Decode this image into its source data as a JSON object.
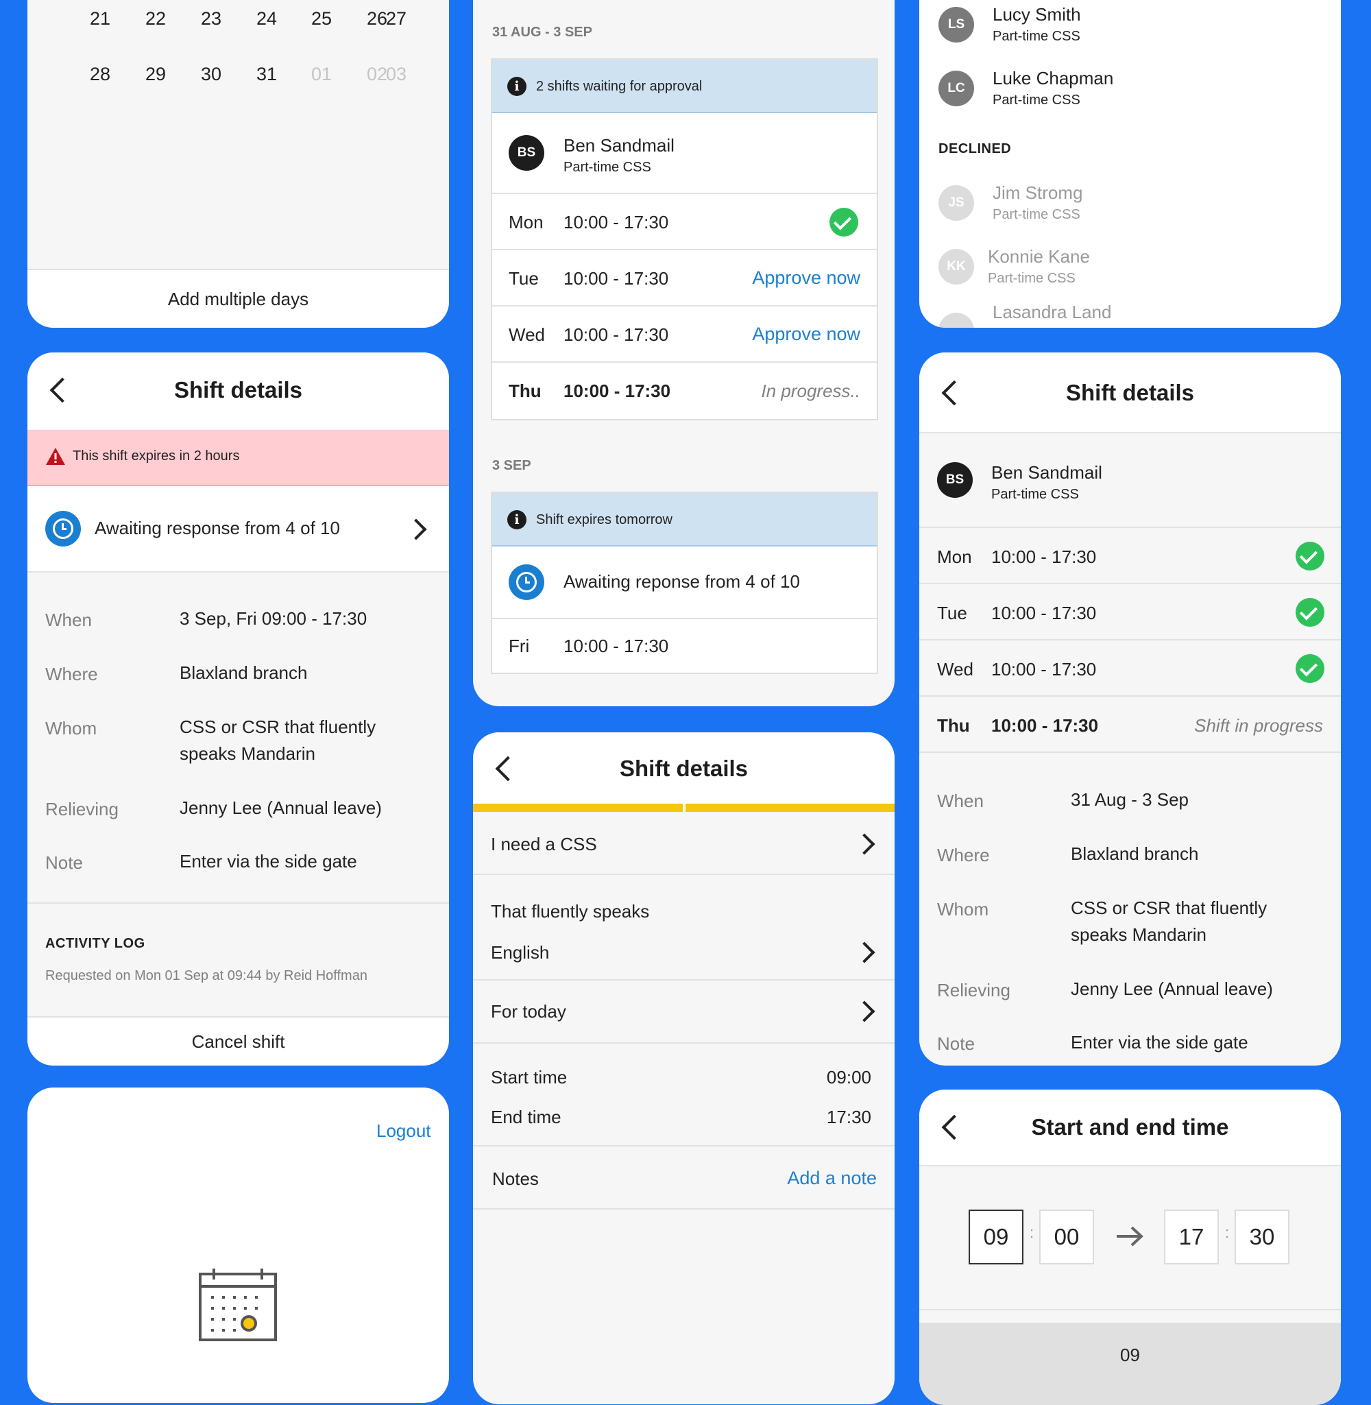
{
  "calendar_card": {
    "week1": [
      "21",
      "22",
      "23",
      "24",
      "25",
      "26",
      "27"
    ],
    "week2": [
      "28",
      "29",
      "30",
      "31",
      "01",
      "02",
      "03"
    ],
    "add_multiple_label": "Add multiple days"
  },
  "shift_left": {
    "title": "Shift details",
    "alert": "This shift expires in 2 hours",
    "awaiting": "Awaiting response from 4 of 10",
    "details": [
      {
        "label": "When",
        "value": "3 Sep, Fri 09:00 - 17:30"
      },
      {
        "label": "Where",
        "value": "Blaxland branch"
      },
      {
        "label": "Whom",
        "value": "CSS or CSR that fluently speaks Mandarin"
      },
      {
        "label": "Relieving",
        "value": "Jenny Lee (Annual leave)"
      },
      {
        "label": "Note",
        "value": "Enter via the side gate"
      }
    ],
    "activity_heading": "ACTIVITY LOG",
    "activity_entry": "Requested on Mon 01 Sep at 09:44 by Reid Hoffman",
    "cancel_label": "Cancel shift"
  },
  "logout_card": {
    "logout_label": "Logout"
  },
  "shift_list": {
    "group1_heading": "31 AUG - 3 SEP",
    "group1_banner": "2 shifts waiting for approval",
    "person": {
      "initials": "BS",
      "name": "Ben Sandmail",
      "role": "Part-time CSS"
    },
    "rows": [
      {
        "day": "Mon",
        "time": "10:00 - 17:30",
        "status": "approved"
      },
      {
        "day": "Tue",
        "time": "10:00 - 17:30",
        "status": "Approve now"
      },
      {
        "day": "Wed",
        "time": "10:00 - 17:30",
        "status": "Approve now"
      },
      {
        "day": "Thu",
        "time": "10:00 - 17:30",
        "status": "In progress.."
      }
    ],
    "group2_heading": "3 SEP",
    "group2_banner": "Shift expires tomorrow",
    "group2_awaiting": "Awaiting reponse from 4 of 10",
    "group2_row": {
      "day": "Fri",
      "time": "10:00 - 17:30"
    }
  },
  "shift_form": {
    "title": "Shift details",
    "progress": 1.0,
    "need_label": "I need a CSS",
    "speaks_label": "That fluently speaks",
    "speaks_value": "English",
    "when_label": "For today",
    "start_label": "Start time",
    "start_value": "09:00",
    "end_label": "End time",
    "end_value": "17:30",
    "notes_label": "Notes",
    "add_note_label": "Add a note"
  },
  "responders": {
    "accepted": [
      {
        "initials": "LS",
        "name": "Lucy Smith",
        "role": "Part-time CSS"
      },
      {
        "initials": "LC",
        "name": "Luke Chapman",
        "role": "Part-time CSS"
      }
    ],
    "declined_heading": "DECLINED",
    "declined": [
      {
        "initials": "JS",
        "name": "Jim Stromg",
        "role": "Part-time CSS"
      },
      {
        "initials": "KK",
        "name": "Konnie Kane",
        "role": "Part-time CSS"
      },
      {
        "initials": "",
        "name": "Lasandra Land",
        "role": ""
      }
    ]
  },
  "shift_right": {
    "title": "Shift details",
    "person": {
      "initials": "BS",
      "name": "Ben Sandmail",
      "role": "Part-time CSS"
    },
    "rows": [
      {
        "day": "Mon",
        "time": "10:00 - 17:30",
        "status": "approved"
      },
      {
        "day": "Tue",
        "time": "10:00 - 17:30",
        "status": "approved"
      },
      {
        "day": "Wed",
        "time": "10:00 - 17:30",
        "status": "approved"
      },
      {
        "day": "Thu",
        "time": "10:00 - 17:30",
        "status": "Shift in progress"
      }
    ],
    "details": [
      {
        "label": "When",
        "value": "31 Aug - 3 Sep"
      },
      {
        "label": "Where",
        "value": "Blaxland branch"
      },
      {
        "label": "Whom",
        "value": "CSS or CSR that fluently speaks Mandarin"
      },
      {
        "label": "Relieving",
        "value": "Jenny Lee (Annual leave)"
      },
      {
        "label": "Note",
        "value": "Enter via the side gate"
      }
    ]
  },
  "time_picker": {
    "title": "Start and end time",
    "start_hour": "09",
    "start_min": "00",
    "colon": ":",
    "end_hour": "17",
    "end_min": "30",
    "wheel_value": "09"
  },
  "colors": {
    "background": "#1a73f2",
    "accent_blue": "#1b7fd1",
    "alert_pink": "#ffcdd2",
    "info_blue": "#cfe2f1",
    "progress_yellow": "#f7c50b",
    "approved_green": "#2fc25b"
  }
}
